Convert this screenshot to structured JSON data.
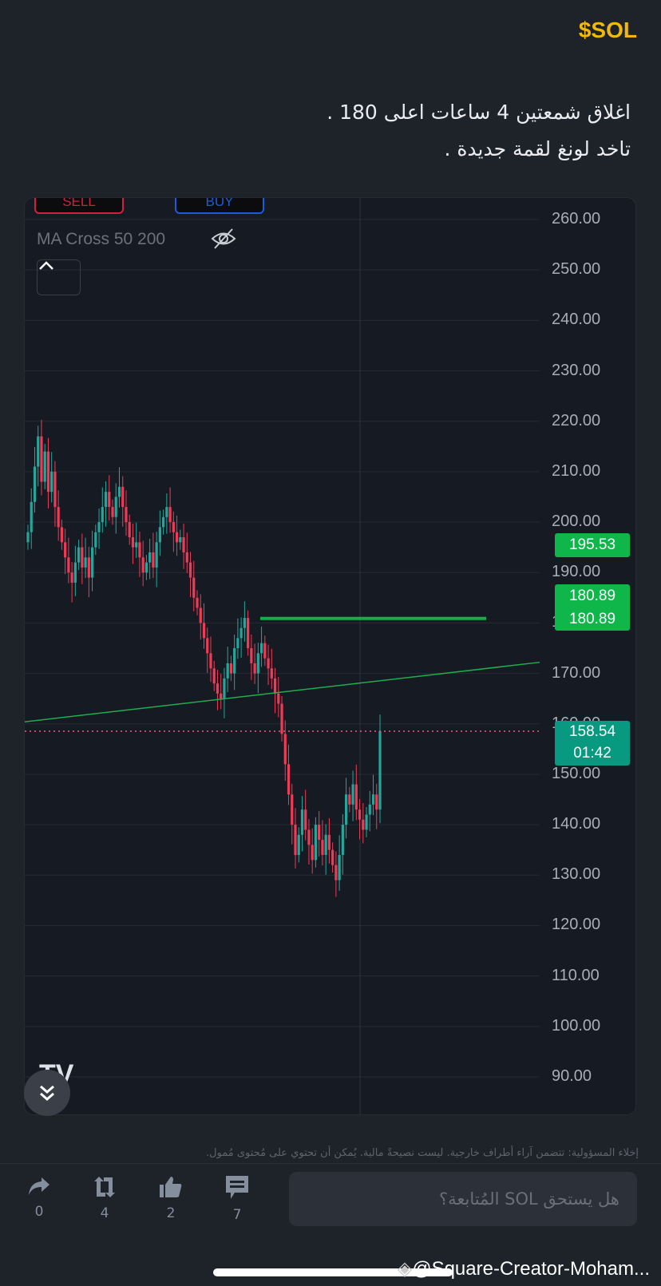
{
  "post": {
    "ticker": "$SOL",
    "lines": [
      "اغلاق شمعتين 4 ساعات اعلى 180 .",
      "تاخد لونغ لقمة جديدة ."
    ]
  },
  "chart": {
    "sell_label": "SELL",
    "buy_label": "BUY",
    "indicator_label": "MA Cross 50 200",
    "price_tags": {
      "ma_price": "195.53",
      "level_1": "180.89",
      "level_2": "180.89",
      "last_price": "158.54",
      "countdown": "01:42"
    },
    "colors": {
      "up": "#26a69a",
      "down": "#ef3b55",
      "tag_green": "#0fb64a",
      "last_tag": "#089981"
    }
  },
  "chart_data": {
    "type": "candlestick",
    "y_ticks": [
      "260.00",
      "250.00",
      "240.00",
      "230.00",
      "220.00",
      "210.00",
      "200.00",
      "190.00",
      "180.00",
      "170.00",
      "160.00",
      "150.00",
      "140.00",
      "130.00",
      "120.00",
      "110.00",
      "100.00",
      "90.00"
    ],
    "ylim": [
      90,
      260
    ],
    "closes": [
      198,
      204,
      211,
      217,
      208,
      214,
      206,
      210,
      203,
      199,
      196,
      193,
      190,
      188,
      192,
      195,
      191,
      193,
      189,
      195,
      198,
      200,
      203,
      206,
      203,
      201,
      205,
      207,
      203,
      200,
      197,
      195,
      196,
      193,
      190,
      192,
      194,
      191,
      196,
      199,
      201,
      203,
      200,
      198,
      196,
      197,
      194,
      192,
      189,
      185,
      183,
      180,
      177,
      174,
      171,
      168,
      166,
      165,
      169,
      172,
      170,
      175,
      177,
      179,
      181,
      175,
      172,
      170,
      174,
      176,
      173,
      171,
      169,
      166,
      164,
      158,
      152,
      146,
      140,
      134,
      138,
      143,
      139,
      136,
      133,
      140,
      137,
      134,
      138,
      135,
      132,
      129,
      134,
      140,
      146,
      144,
      148,
      143,
      141,
      139,
      142,
      144,
      146,
      143,
      158.54
    ],
    "horizontal_level": 180.89,
    "trendline": [
      160.4,
      172.2
    ],
    "last_price": 158.54
  },
  "footer": {
    "disclaimer": "إخلاء المسؤولية: تتضمن آراء أطراف خارجية. ليست نصيحةً مالية. يُمكن أن تحتوي على مُحتوى مُمول.",
    "share_count": "0",
    "repost_count": "4",
    "like_count": "2",
    "comment_count": "7",
    "comment_placeholder": "هل يستحق SOL المُتابعة؟",
    "watermark": "@Square-Creator-Moham..."
  }
}
